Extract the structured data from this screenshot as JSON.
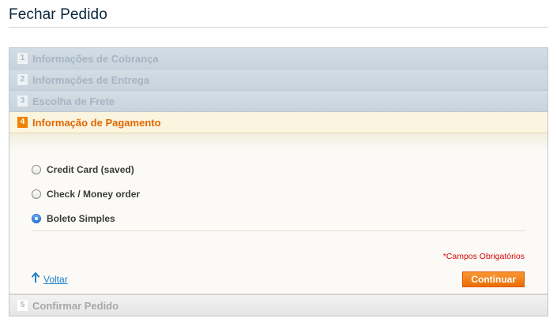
{
  "page": {
    "title": "Fechar Pedido"
  },
  "steps": [
    {
      "number": "1",
      "title": "Informações de Cobrança"
    },
    {
      "number": "2",
      "title": "Informações de Entrega"
    },
    {
      "number": "3",
      "title": "Escolha de Frete"
    },
    {
      "number": "4",
      "title": "Informação de Pagamento"
    },
    {
      "number": "5",
      "title": "Confirmar Pedido"
    }
  ],
  "payment": {
    "methods": [
      {
        "label": "Credit Card (saved)",
        "selected": false
      },
      {
        "label": "Check / Money order",
        "selected": false
      },
      {
        "label": "Boleto Simples",
        "selected": true
      }
    ],
    "required_note": "*Campos Obrigatórios",
    "back_label": "Voltar",
    "continue_label": "Continuar"
  },
  "colors": {
    "accent": "#f18200",
    "active_title": "#e26703",
    "link": "#1e7ec8",
    "required": "#d40707"
  },
  "icons": {
    "back": "arrow-up-icon"
  }
}
